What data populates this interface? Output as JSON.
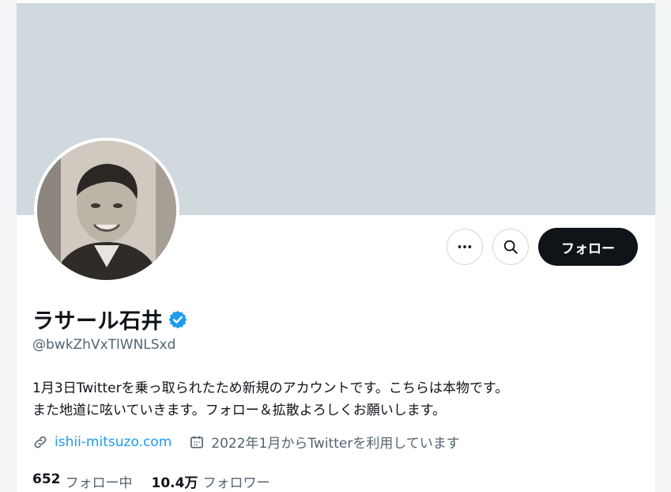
{
  "profile": {
    "name": "ラサール石井",
    "handle": "@bwkZhVxTlWNLSxd",
    "bio_line1": "1月3日Twitterを乗っ取られたため新規のアカウントです。こちらは本物です。",
    "bio_line2": "また地道に呟いていきます。フォロー＆拡散よろしくお願いします。",
    "website": "ishii-mitsuzo.com",
    "joined": "2022年1月からTwitterを利用しています"
  },
  "actions": {
    "more_icon": "more-horizontal-icon",
    "search_icon": "search-icon",
    "follow_label": "フォロー"
  },
  "stats": {
    "following_count": "652",
    "following_label": "フォロー中",
    "followers_count": "10.4万",
    "followers_label": "フォロワー"
  },
  "colors": {
    "banner": "#cfd9de",
    "verified": "#1d9bf0",
    "link": "#1d9bf0",
    "follow_button": "#0f1419"
  }
}
